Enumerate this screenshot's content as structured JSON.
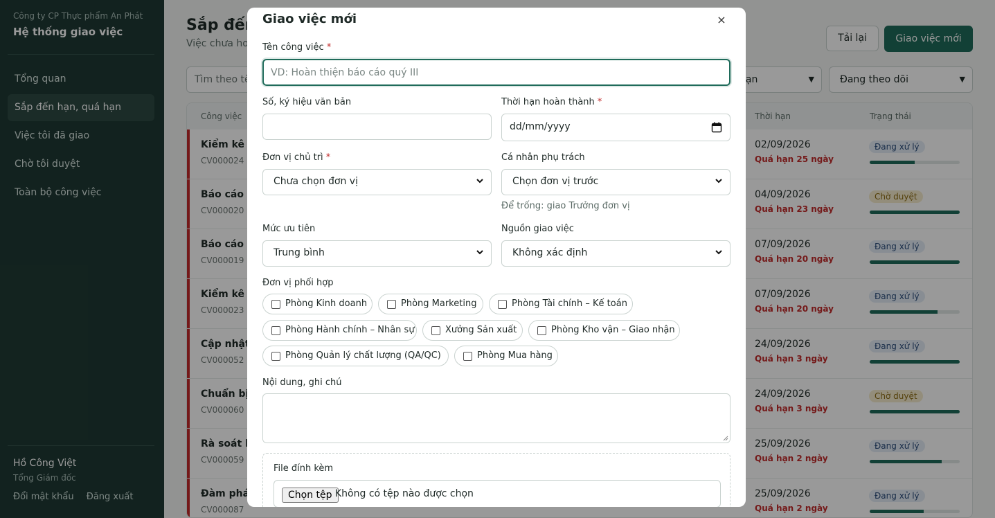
{
  "sidebar": {
    "company": "Công ty CP Thực phẩm An Phát",
    "app_title": "Hệ thống giao việc",
    "nav": [
      {
        "label": "Tổng quan"
      },
      {
        "label": "Sắp đến hạn, quá hạn"
      },
      {
        "label": "Việc tôi đã giao"
      },
      {
        "label": "Chờ tôi duyệt"
      },
      {
        "label": "Toàn bộ công việc"
      }
    ],
    "user_name": "Hồ Công Việt",
    "user_role": "Tổng Giám đốc",
    "change_password": "Đổi mật khẩu",
    "logout": "Đăng xuất"
  },
  "main": {
    "title": "Sắp đến",
    "subtitle": "Việc chưa ho",
    "reload_label": "Tải lại",
    "new_task_label": "Giao việc mới",
    "search_placeholder": "Tìm theo tê",
    "filter_1": "hạn",
    "filter_2": "Đang theo dõi",
    "columns": {
      "task": "Công việc",
      "deadline": "Thời hạn",
      "status": "Trạng thái"
    },
    "rows": [
      {
        "name": "Kiểm kê kh",
        "code": "CV000024",
        "date": "02/09/2026",
        "overdue": "Quá hạn 25 ngày",
        "status": "Đang xử lý",
        "progress": 0.5
      },
      {
        "name": "Báo cáo c",
        "code": "CV000020",
        "date": "04/09/2026",
        "overdue": "Quá hạn 23 ngày",
        "status": "Chờ duyệt",
        "progress": 1.0
      },
      {
        "name": "Báo cáo c",
        "code": "CV000019",
        "date": "07/09/2026",
        "overdue": "Quá hạn 20 ngày",
        "status": "Đang xử lý",
        "progress": 1.0
      },
      {
        "name": "Kiểm kê kh",
        "code": "CV000023",
        "date": "07/09/2026",
        "overdue": "Quá hạn 20 ngày",
        "status": "Đang xử lý",
        "progress": 0.75
      },
      {
        "name": "Cập nhật",
        "code": "CV000052",
        "date": "24/09/2026",
        "overdue": "Quá hạn 3 ngày",
        "status": "Đang xử lý",
        "progress": 1.0
      },
      {
        "name": "Chuẩn bị g",
        "code": "CV000060",
        "date": "24/09/2026",
        "overdue": "Quá hạn 3 ngày",
        "status": "Chờ duyệt",
        "progress": 1.0
      },
      {
        "name": "Rà soát ho",
        "code": "CV000059",
        "date": "25/09/2026",
        "overdue": "Quá hạn 2 ngày",
        "status": "Đang xử lý",
        "progress": 0.8
      },
      {
        "name": "Đàm phán",
        "code": "CV000087",
        "date": "25/09/2026",
        "overdue": "Quá hạn 2 ngày",
        "status": "Đang xử lý",
        "progress": 0.6
      }
    ]
  },
  "modal": {
    "title": "Giao việc mới",
    "close": "×",
    "required_mark": "*",
    "task_name_label": "Tên công việc",
    "task_name_placeholder": "VD: Hoàn thiện báo cáo quý III",
    "doc_number_label": "Số, ký hiệu văn bản",
    "deadline_label": "Thời hạn hoàn thành",
    "deadline_placeholder": "dd/mm/yyyy",
    "lead_unit_label": "Đơn vị chủ trì",
    "lead_unit_value": "Chưa chọn đơn vị",
    "assignee_label": "Cá nhân phụ trách",
    "assignee_value": "Chọn đơn vị trước",
    "assignee_hint": "Để trống: giao Trưởng đơn vị",
    "priority_label": "Mức ưu tiên",
    "priority_value": "Trung bình",
    "source_label": "Nguồn giao việc",
    "source_value": "Không xác định",
    "coop_label": "Đơn vị phối hợp",
    "coop_units": [
      "Phòng Kinh doanh",
      "Phòng Marketing",
      "Phòng Tài chính – Kế toán",
      "Phòng Hành chính – Nhân sự",
      "Xưởng Sản xuất",
      "Phòng Kho vận – Giao nhận",
      "Phòng Quản lý chất lượng (QA/QC)",
      "Phòng Mua hàng"
    ],
    "notes_label": "Nội dung, ghi chú",
    "attach_label": "File đính kèm",
    "choose_file": "Chọn tệp",
    "no_file": "Không có tệp nào được chọn"
  },
  "colors": {
    "sidebar_bg": "#1f3a34",
    "accent": "#1f6b5a",
    "danger": "#c22b2b",
    "status_processing_bg": "#e3ebf5",
    "status_pending_bg": "#f6eccd"
  }
}
